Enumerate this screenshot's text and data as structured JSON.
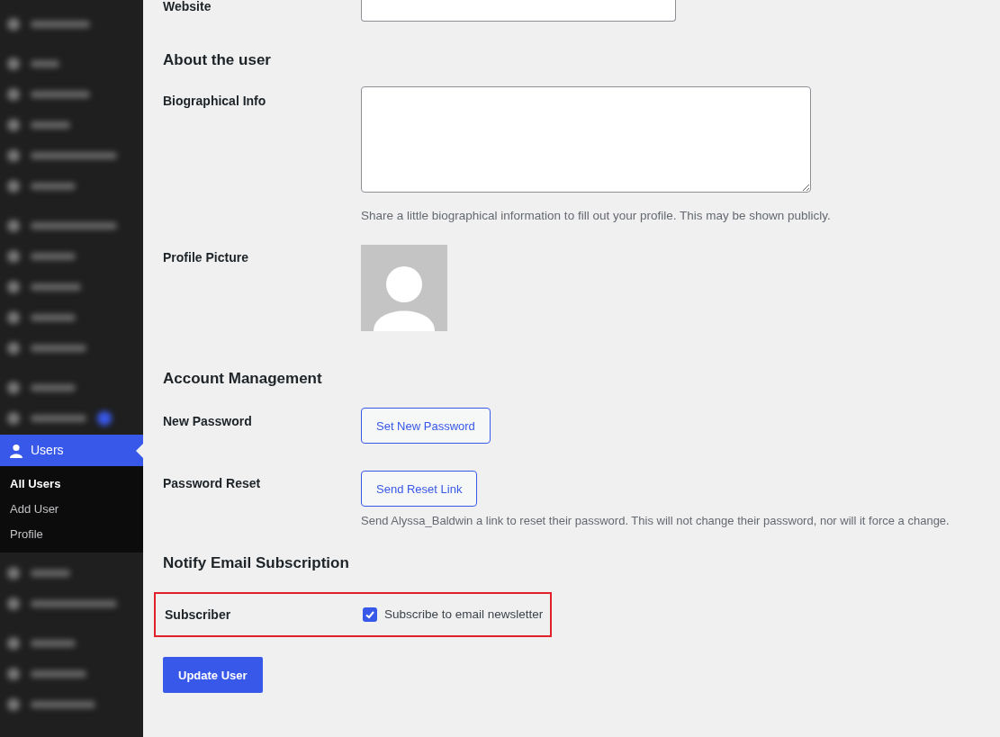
{
  "sidebar": {
    "groups_before": [
      [
        {
          "badge": false
        }
      ],
      [
        {
          "badge": false
        },
        {
          "badge": false
        },
        {
          "badge": false
        },
        {
          "badge": false
        },
        {
          "badge": false
        }
      ],
      [
        {
          "badge": false
        },
        {
          "badge": false
        },
        {
          "badge": false
        },
        {
          "badge": false
        },
        {
          "badge": false
        }
      ],
      [
        {
          "badge": false
        },
        {
          "badge": true
        }
      ]
    ],
    "current": {
      "label": "Users",
      "submenu": [
        {
          "label": "All Users",
          "selected": true
        },
        {
          "label": "Add User",
          "selected": false
        },
        {
          "label": "Profile",
          "selected": false
        }
      ]
    },
    "groups_after": [
      [
        {
          "badge": false
        },
        {
          "badge": false
        }
      ],
      [
        {
          "badge": false
        },
        {
          "badge": false
        },
        {
          "badge": false
        }
      ]
    ]
  },
  "website": {
    "label": "Website"
  },
  "about": {
    "heading": "About the user",
    "bio_label": "Biographical Info",
    "bio_description": "Share a little biographical information to fill out your profile. This may be shown publicly.",
    "picture_label": "Profile Picture"
  },
  "account": {
    "heading": "Account Management",
    "new_password_label": "New Password",
    "new_password_button": "Set New Password",
    "reset_label": "Password Reset",
    "reset_button": "Send Reset Link",
    "reset_description": "Send Alyssa_Baldwin a link to reset their password. This will not change their password, nor will it force a change."
  },
  "notify": {
    "heading": "Notify Email Subscription",
    "label": "Subscriber",
    "checkbox_label": "Subscribe to email newsletter",
    "checked": true,
    "highlighted": true
  },
  "submit": "Update User"
}
